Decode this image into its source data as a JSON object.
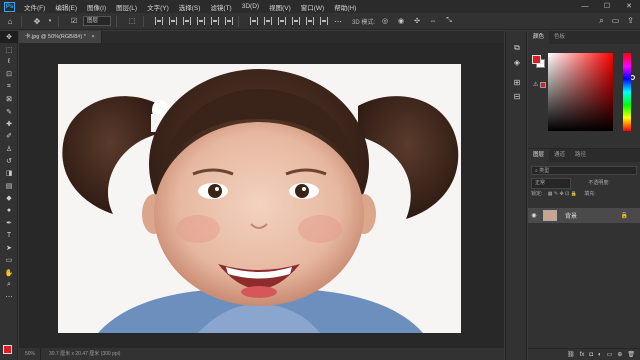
{
  "menubar": {
    "items": [
      "文件(F)",
      "编辑(E)",
      "图像(I)",
      "图层(L)",
      "文字(Y)",
      "选择(S)",
      "滤镜(T)",
      "3D(D)",
      "视图(V)",
      "窗口(W)",
      "帮助(H)"
    ],
    "logo": "Ps",
    "controls": [
      "—",
      "☐",
      "✕"
    ]
  },
  "optionsbar": {
    "select_value": "图层",
    "mode_label": "3D 模式:"
  },
  "document": {
    "tab_title": "卡.jpg @ 50%(RGB/8#) *",
    "close_glyph": "×"
  },
  "statusbar": {
    "zoom": "50%",
    "doc_info": "30.7 厘米 x 20.47 厘米 (300 ppi)"
  },
  "color_panel": {
    "tabs": [
      "颜色",
      "色板"
    ]
  },
  "layers_panel": {
    "tabs": [
      "图层",
      "通道",
      "路径"
    ],
    "filter_label": "类型",
    "blend_mode": "正常",
    "opacity_label": "不透明度:",
    "lock_label": "锁定:",
    "fill_label": "填充:",
    "layer_name": "背景"
  },
  "colors": {
    "foreground": "#e01b24",
    "background": "#ffffff"
  }
}
